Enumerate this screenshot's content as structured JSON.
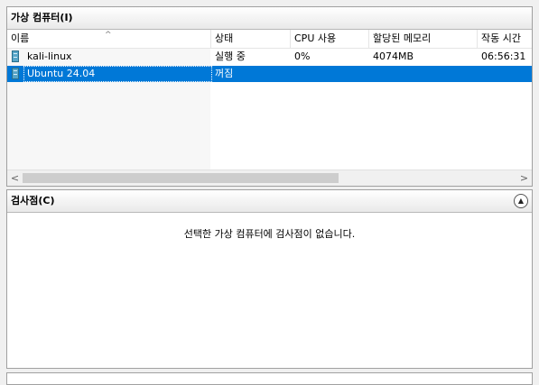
{
  "vm_panel": {
    "title": "가상 컴퓨터(I)",
    "columns": [
      "이름",
      "상태",
      "CPU 사용",
      "할당된 메모리",
      "작동 시간"
    ],
    "rows": [
      {
        "name": "kali-linux",
        "state": "실행 중",
        "cpu": "0%",
        "memory": "4074MB",
        "uptime": "06:56:31",
        "selected": false
      },
      {
        "name": "Ubuntu 24.04",
        "state": "꺼짐",
        "cpu": "",
        "memory": "",
        "uptime": "",
        "selected": true
      }
    ],
    "sort_indicator": "^",
    "scroll": {
      "left_arrow": "<",
      "right_arrow": ">"
    }
  },
  "checkpoint_panel": {
    "title": "검사점(C)",
    "empty_message": "선택한 가상 컴퓨터에 검사점이 없습니다.",
    "collapse_glyph": "▲"
  },
  "icons": {
    "vm": "virtual-machine-icon"
  }
}
